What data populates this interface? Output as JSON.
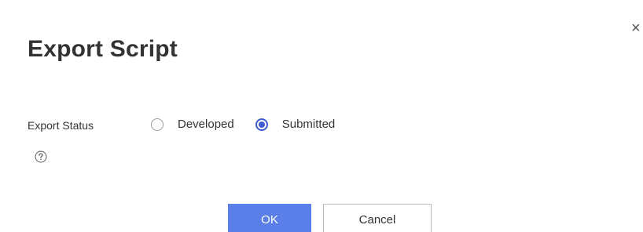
{
  "dialog": {
    "title": "Export Script",
    "close_glyph": "×"
  },
  "form": {
    "export_status_label": "Export Status",
    "options": [
      {
        "label": "Developed",
        "checked": false
      },
      {
        "label": "Submitted",
        "checked": true
      }
    ],
    "help_icon": "question-circle-icon"
  },
  "footer": {
    "ok_label": "OK",
    "cancel_label": "Cancel"
  },
  "colors": {
    "accent": "#3f5ccf",
    "primary_button": "#5b7fe8"
  }
}
